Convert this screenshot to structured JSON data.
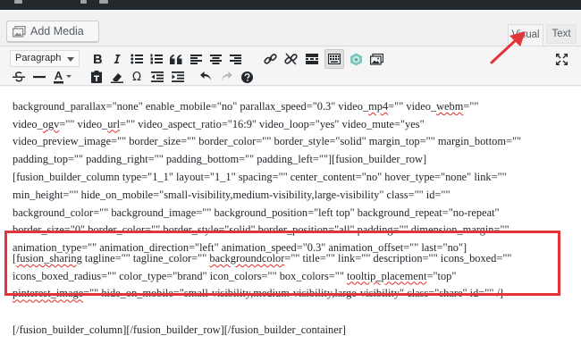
{
  "toolbar_top": {
    "add_media_label": "Add Media",
    "tabs": [
      {
        "label": "Visual",
        "active": true
      },
      {
        "label": "Text",
        "active": false
      }
    ]
  },
  "editor_toolbar": {
    "format_select_value": "Paragraph",
    "buttons": [
      "bold-icon",
      "italic-icon",
      "bullet-list-icon",
      "numbered-list-icon",
      "blockquote-icon",
      "align-left-icon",
      "align-center-icon",
      "align-right-icon",
      "insert-link-icon",
      "remove-link-icon",
      "read-more-icon",
      "toolbar-toggle-icon",
      "fusion-builder-icon",
      "add-media-icon",
      "fullscreen-icon",
      "strikethrough-icon",
      "horizontal-line-icon",
      "text-color-icon",
      "paste-as-text-icon",
      "clear-formatting-icon",
      "special-character-icon",
      "decrease-indent-icon",
      "increase-indent-icon",
      "undo-icon",
      "redo-icon",
      "help-icon"
    ],
    "text_color": "#23282d"
  },
  "editor": {
    "lines_top": [
      "background_parallax=\"none\" enable_mobile=\"no\" parallax_speed=\"0.3\" video_mp4=\"\" video_webm=\"\"",
      "video_ogv=\"\" video_url=\"\" video_aspect_ratio=\"16:9\" video_loop=\"yes\" video_mute=\"yes\"",
      "video_preview_image=\"\" border_size=\"\" border_color=\"\" border_style=\"solid\" margin_top=\"\" margin_bottom=\"\"",
      "padding_top=\"\" padding_right=\"\" padding_bottom=\"\" padding_left=\"\"][fusion_builder_row]",
      "[fusion_builder_column type=\"1_1\" layout=\"1_1\" spacing=\"\" center_content=\"no\" hover_type=\"none\" link=\"\"",
      "min_height=\"\" hide_on_mobile=\"small-visibility,medium-visibility,large-visibility\" class=\"\" id=\"\"",
      "background_color=\"\" background_image=\"\" background_position=\"left top\" background_repeat=\"no-repeat\"",
      "border_size=\"0\" border_color=\"\" border_style=\"solid\" border_position=\"all\" padding=\"\" dimension_margin=\"\"",
      "animation_type=\"\" animation_direction=\"left\" animation_speed=\"0.3\" animation_offset=\"\" last=\"no\"]"
    ],
    "lines_sharing": [
      "[fusion_sharing tagline=\"\" tagline_color=\"\" backgroundcolor=\"\" title=\"\" link=\"\" description=\"\" icons_boxed=\"\"",
      "icons_boxed_radius=\"\" color_type=\"brand\" icon_colors=\"\" box_colors=\"\" tooltip_placement=\"top\"",
      "pinterest_image=\"\" hide_on_mobile=\"small-visibility,medium-visibility,large-visibility\" class=\"share\" id=\"\" /]"
    ],
    "line_close": "[/fusion_builder_column][/fusion_builder_row][/fusion_builder_container]",
    "spellcheck_words": [
      "mp4",
      "webm",
      "ogv",
      "url",
      "fusion_sharing",
      "backgroundcolor",
      "tooltip_placement",
      "pinterest_image"
    ]
  },
  "annotation": {
    "highlight_color": "#e3343a",
    "arrow_color": "#e3343a"
  }
}
